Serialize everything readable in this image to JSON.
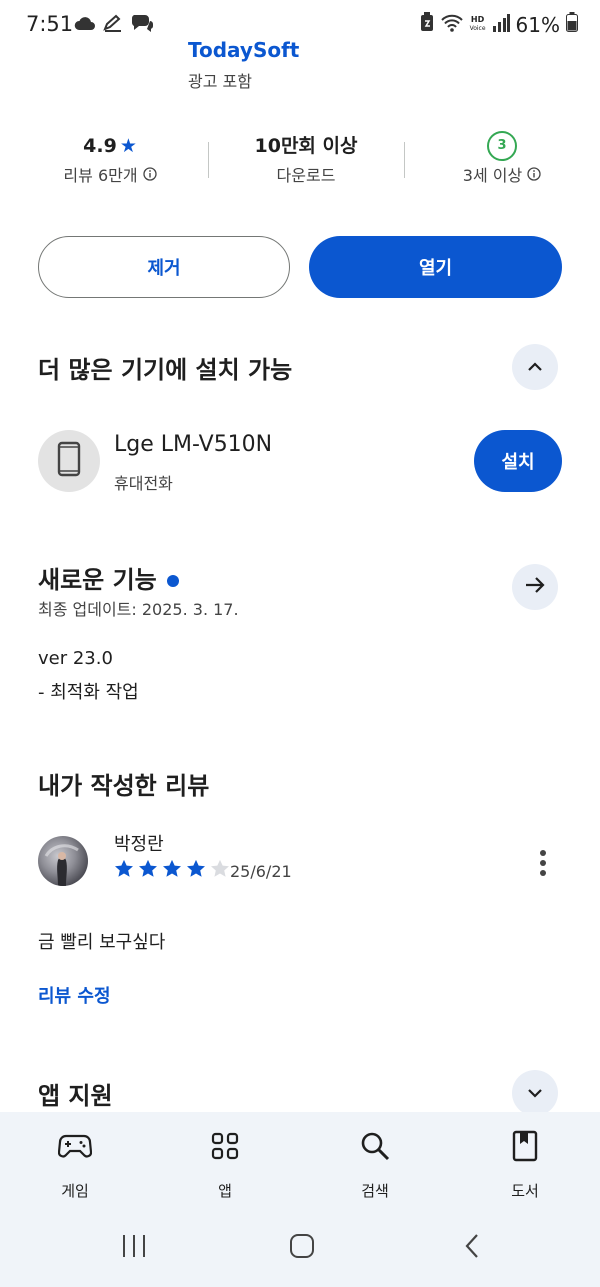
{
  "status_bar": {
    "time": "7:51",
    "battery": "61%",
    "network_badge_top": "HD",
    "network_badge_bottom": "Voice"
  },
  "app": {
    "developer": "TodaySoft",
    "ads_note": "광고 포함"
  },
  "stats": {
    "rating_value": "4.9",
    "rating_star": "★",
    "reviews": "리뷰 6만개",
    "downloads_value": "10만회 이상",
    "downloads_label": "다운로드",
    "age_badge": "3",
    "age_label": "3세 이상"
  },
  "actions": {
    "remove_label": "제거",
    "open_label": "열기"
  },
  "more_devices": {
    "title": "더 많은 기기에 설치 가능",
    "device_name": "Lge LM-V510N",
    "device_type": "휴대전화",
    "install_label": "설치"
  },
  "whats_new": {
    "title": "새로운 기능",
    "updated": "최종 업데이트: 2025. 3. 17.",
    "line1": "ver 23.0",
    "line2": "- 최적화 작업"
  },
  "my_review": {
    "title": "내가 작성한 리뷰",
    "reviewer": "박정란",
    "rating": 4,
    "rating_max": 5,
    "date": "25/6/21",
    "text": "금 빨리 보구싶다",
    "edit_label": "리뷰 수정"
  },
  "app_support": {
    "title": "앱 지원"
  },
  "bottom_nav": {
    "items": [
      {
        "label": "게임",
        "icon": "gamepad-icon"
      },
      {
        "label": "앱",
        "icon": "apps-grid-icon"
      },
      {
        "label": "검색",
        "icon": "search-icon"
      },
      {
        "label": "도서",
        "icon": "book-icon"
      }
    ]
  },
  "colors": {
    "accent": "#0b57d0",
    "age_green": "#34a853",
    "nav_bg": "#f0f4f9"
  }
}
